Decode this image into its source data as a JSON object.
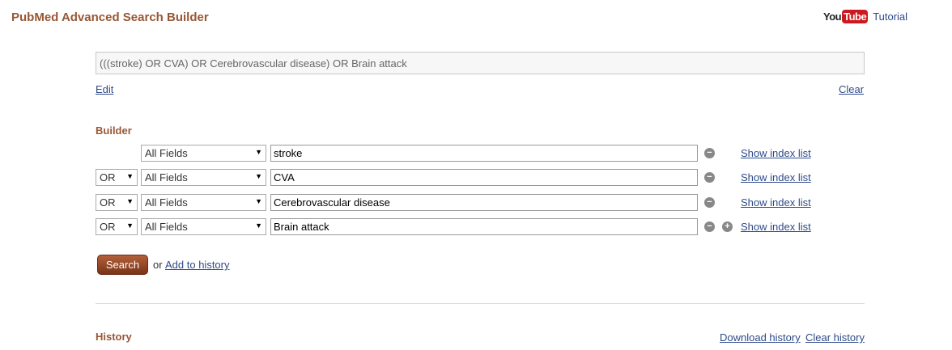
{
  "header": {
    "title": "PubMed Advanced Search Builder",
    "youtube_you": "You",
    "youtube_tube": "Tube",
    "tutorial_label": "Tutorial"
  },
  "query": {
    "text": "(((stroke) OR CVA) OR Cerebrovascular disease) OR Brain attack",
    "edit_label": "Edit",
    "clear_label": "Clear"
  },
  "builder": {
    "label": "Builder",
    "rows": [
      {
        "operator": "",
        "field": "All Fields",
        "term": "stroke",
        "index_label": "Show index list"
      },
      {
        "operator": "OR",
        "field": "All Fields",
        "term": "CVA",
        "index_label": "Show index list"
      },
      {
        "operator": "OR",
        "field": "All Fields",
        "term": "Cerebrovascular disease",
        "index_label": "Show index list"
      },
      {
        "operator": "OR",
        "field": "All Fields",
        "term": "Brain attack",
        "index_label": "Show index list"
      }
    ],
    "search_label": "Search",
    "or_text": "or",
    "add_history_label": "Add to history"
  },
  "history": {
    "label": "History",
    "download_label": "Download history",
    "clear_label": "Clear history"
  },
  "colors": {
    "accent": "#985735",
    "link": "#2f4a8a",
    "search_button": "#8b3f1f"
  }
}
